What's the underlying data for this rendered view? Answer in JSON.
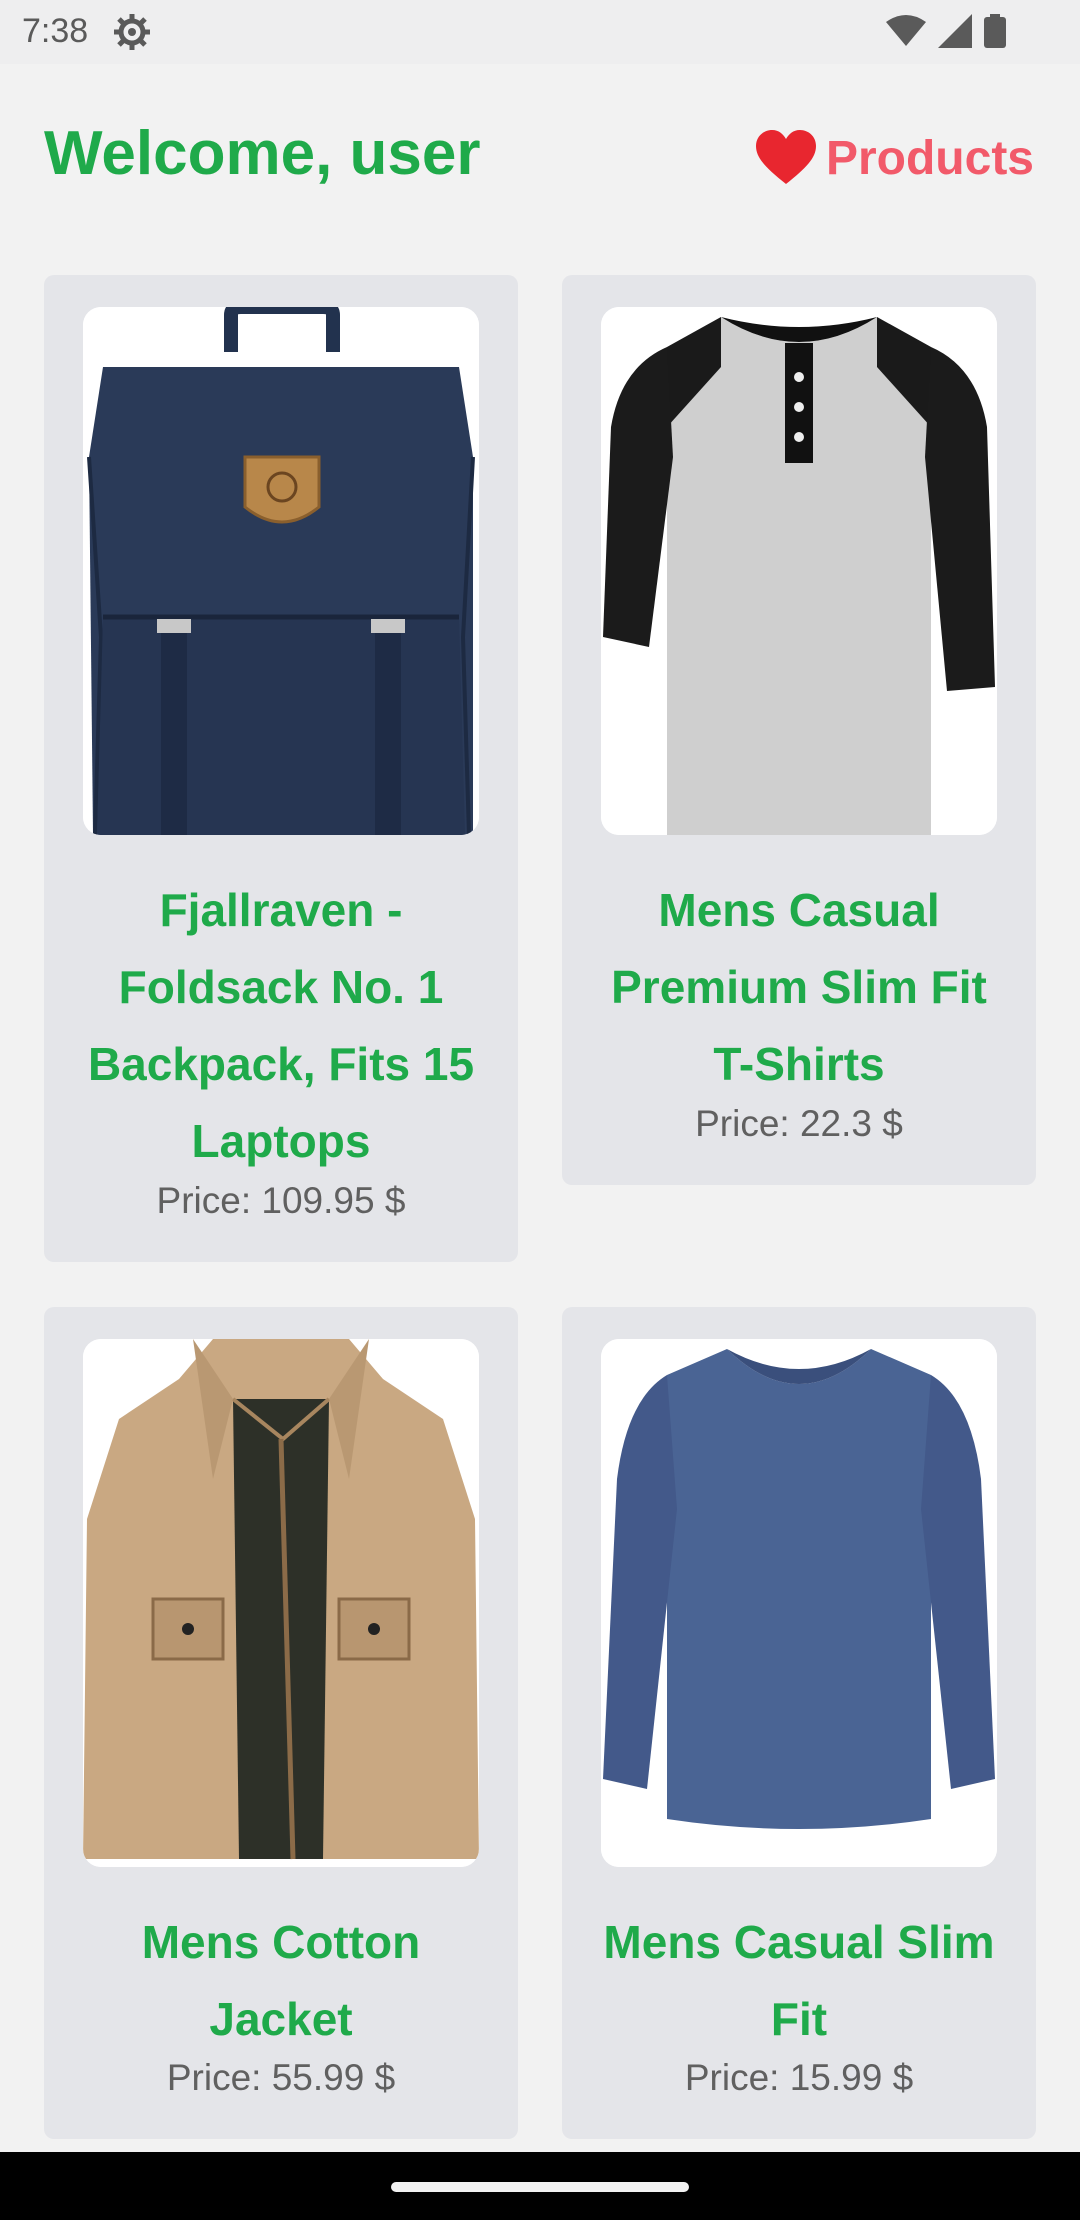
{
  "status": {
    "time": "7:38"
  },
  "header": {
    "welcome": "Welcome, user",
    "products_label": "Products"
  },
  "products": [
    {
      "title": "Fjallraven - Foldsack No. 1 Backpack, Fits 15 Laptops",
      "price": "Price: 109.95 $",
      "image_icon": "backpack-image"
    },
    {
      "title": "Mens Casual Premium Slim Fit T-Shirts",
      "price": "Price: 22.3 $",
      "image_icon": "tshirt-image"
    },
    {
      "title": "Mens Cotton Jacket",
      "price": "Price: 55.99 $",
      "image_icon": "jacket-image"
    },
    {
      "title": "Mens Casual Slim Fit",
      "price": "Price: 15.99 $",
      "image_icon": "longsleeve-image"
    }
  ],
  "colors": {
    "accent_green": "#1faa4a",
    "heart_red": "#e8262f",
    "products_pink": "#f25a6a",
    "card_bg": "#e4e5e9"
  }
}
